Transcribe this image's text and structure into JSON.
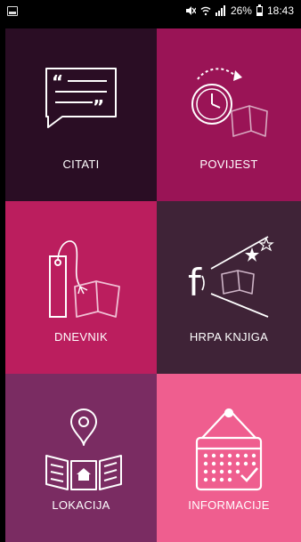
{
  "status_bar": {
    "battery_percent": "26%",
    "time": "18:43"
  },
  "tiles": [
    {
      "label": "CITATI",
      "icon": "quote-bubble-icon",
      "color": "#2a0d24"
    },
    {
      "label": "POVIJEST",
      "icon": "clock-book-icon",
      "color": "#9a1456"
    },
    {
      "label": "DNEVNIK",
      "icon": "bookmark-book-icon",
      "color": "#bb1e5e"
    },
    {
      "label": "HRPA KNJIGA",
      "icon": "facebook-book-icon",
      "color": "#3f2337"
    },
    {
      "label": "LOKACIJA",
      "icon": "map-pin-icon",
      "color": "#7a2c62"
    },
    {
      "label": "INFORMACIJE",
      "icon": "calendar-icon",
      "color": "#ef5e8f"
    }
  ]
}
